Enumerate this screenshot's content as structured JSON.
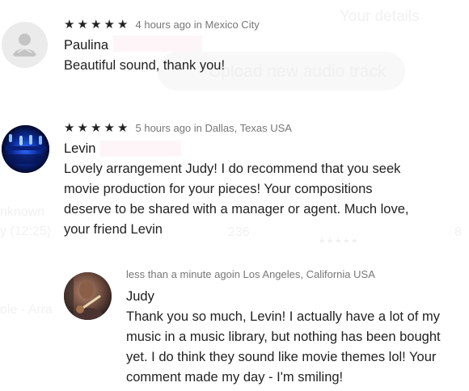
{
  "background_page": {
    "section_heading": "Your details",
    "upload_button_label": "Upload new audio track",
    "list_fragments": [
      "nknown",
      "y (12:25)",
      "ole - Arra",
      "236",
      "8"
    ]
  },
  "comments": [
    {
      "rating": 5,
      "time": "4 hours ago",
      "location_prefix": " in ",
      "location": "Mexico City",
      "author": "Paulina",
      "text": "Beautiful sound, thank you!",
      "avatar_icon": "default-person-icon"
    },
    {
      "rating": 5,
      "time": "5 hours ago",
      "location_prefix": " in ",
      "location": "Dallas, Texas USA",
      "author": "Levin",
      "text_lines": [
        "Lovely arrangement Judy! I do recommend that you seek",
        "movie production for your pieces! Your compositions",
        "deserve to be shared with a manager or agent. Much love,",
        "your friend Levin"
      ],
      "avatar_icon": "blue-lights-photo"
    }
  ],
  "reply": {
    "time": "less than a minute ago",
    "location_prefix": "in ",
    "location": "Los Angeles, California USA",
    "author": "Judy",
    "text_lines": [
      "Thank you so much, Levin! I actually have a lot of my",
      "music in a music library, but nothing has been bought",
      "yet. I do think they sound like movie themes lol! Your",
      "comment made my day - I'm smiling!"
    ],
    "avatar_icon": "guitarist-photo"
  },
  "colors": {
    "star": "#222222",
    "meta_text": "#777777",
    "body_text": "#222222"
  }
}
